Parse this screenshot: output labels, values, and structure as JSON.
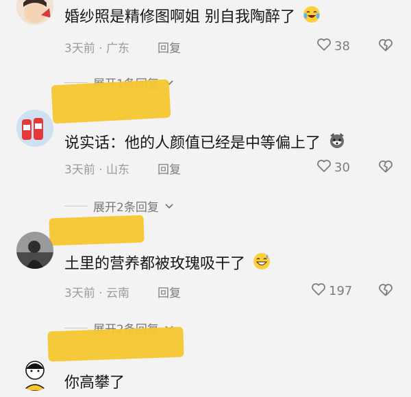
{
  "comments": [
    {
      "text": "婚纱照是精修图啊姐 别自我陶醉了",
      "emoji": "laughing-tears-emoji",
      "meta": "3天前 · 广东",
      "reply_label": "回复",
      "likes": "38",
      "expand_label": "展开1条回复"
    },
    {
      "text": "说实话：他的人颜值已经是中等偏上了",
      "emoji": "husky-dog-emoji",
      "meta": "3天前 · 山东",
      "reply_label": "回复",
      "likes": "30",
      "expand_label": "展开2条回复"
    },
    {
      "text": "土里的营养都被玫瑰吸干了",
      "emoji": "grinning-sweat-emoji",
      "meta": "3天前 · 云南",
      "reply_label": "回复",
      "likes": "197",
      "expand_label": "展开2条回复"
    },
    {
      "text": "你高攀了"
    }
  ],
  "colors": {
    "background": "#f3f3f3",
    "highlight": "#f5c630",
    "meta_text": "#9b9b9b"
  }
}
